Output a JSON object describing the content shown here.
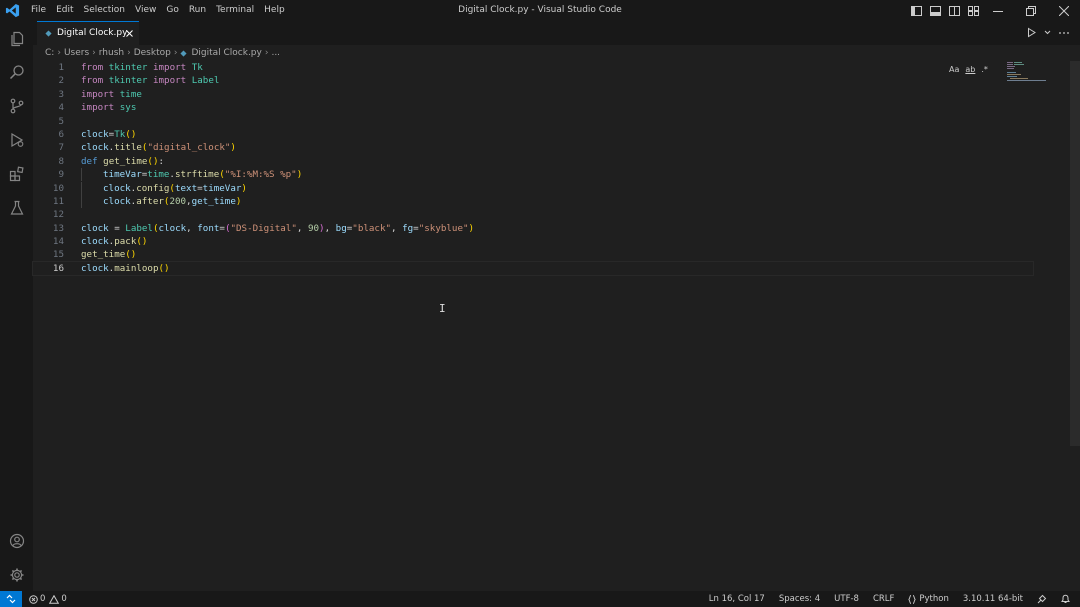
{
  "window": {
    "title": "Digital Clock.py - Visual Studio Code",
    "menu": [
      "File",
      "Edit",
      "Selection",
      "View",
      "Go",
      "Run",
      "Terminal",
      "Help"
    ]
  },
  "tabs": [
    {
      "label": "Digital Clock.py",
      "icon": "python-icon",
      "active": true
    }
  ],
  "breadcrumb": [
    "C:",
    "Users",
    "rhush",
    "Desktop",
    "Digital Clock.py",
    "..."
  ],
  "editor": {
    "current_line": 16,
    "find_widget_labels": [
      "Aa",
      "ab",
      ".*"
    ],
    "code": [
      {
        "n": "1",
        "tokens": [
          [
            "kw",
            "from"
          ],
          [
            "op",
            " "
          ],
          [
            "mod",
            "tkinter"
          ],
          [
            "op",
            " "
          ],
          [
            "kw",
            "import"
          ],
          [
            "op",
            " "
          ],
          [
            "cls",
            "Tk"
          ]
        ]
      },
      {
        "n": "2",
        "tokens": [
          [
            "kw",
            "from"
          ],
          [
            "op",
            " "
          ],
          [
            "mod",
            "tkinter"
          ],
          [
            "op",
            " "
          ],
          [
            "kw",
            "import"
          ],
          [
            "op",
            " "
          ],
          [
            "cls",
            "Label"
          ]
        ]
      },
      {
        "n": "3",
        "tokens": [
          [
            "kw",
            "import"
          ],
          [
            "op",
            " "
          ],
          [
            "mod",
            "time"
          ]
        ]
      },
      {
        "n": "4",
        "tokens": [
          [
            "kw",
            "import"
          ],
          [
            "op",
            " "
          ],
          [
            "mod",
            "sys"
          ]
        ]
      },
      {
        "n": "5",
        "tokens": []
      },
      {
        "n": "6",
        "tokens": [
          [
            "var",
            "clock"
          ],
          [
            "op",
            "="
          ],
          [
            "cls",
            "Tk"
          ],
          [
            "p1",
            "()"
          ]
        ]
      },
      {
        "n": "7",
        "tokens": [
          [
            "var",
            "clock"
          ],
          [
            "op",
            "."
          ],
          [
            "fn",
            "title"
          ],
          [
            "p1",
            "("
          ],
          [
            "str",
            "\"digital_clock\""
          ],
          [
            "p1",
            ")"
          ]
        ]
      },
      {
        "n": "8",
        "tokens": [
          [
            "kw2",
            "def"
          ],
          [
            "op",
            " "
          ],
          [
            "fn",
            "get_time"
          ],
          [
            "p1",
            "()"
          ],
          [
            "op",
            ":"
          ]
        ]
      },
      {
        "n": "9",
        "indent": 1,
        "tokens": [
          [
            "var",
            "timeVar"
          ],
          [
            "op",
            "="
          ],
          [
            "mod",
            "time"
          ],
          [
            "op",
            "."
          ],
          [
            "fn",
            "strftime"
          ],
          [
            "p1",
            "("
          ],
          [
            "str",
            "\"%I:%M:%S %p\""
          ],
          [
            "p1",
            ")"
          ]
        ]
      },
      {
        "n": "10",
        "indent": 1,
        "tokens": [
          [
            "var",
            "clock"
          ],
          [
            "op",
            "."
          ],
          [
            "fn",
            "config"
          ],
          [
            "p1",
            "("
          ],
          [
            "var",
            "text"
          ],
          [
            "op",
            "="
          ],
          [
            "var",
            "timeVar"
          ],
          [
            "p1",
            ")"
          ]
        ]
      },
      {
        "n": "11",
        "indent": 1,
        "tokens": [
          [
            "var",
            "clock"
          ],
          [
            "op",
            "."
          ],
          [
            "fn",
            "after"
          ],
          [
            "p1",
            "("
          ],
          [
            "num",
            "200"
          ],
          [
            "op",
            ","
          ],
          [
            "var",
            "get_time"
          ],
          [
            "p1",
            ")"
          ]
        ]
      },
      {
        "n": "12",
        "tokens": []
      },
      {
        "n": "13",
        "tokens": [
          [
            "var",
            "clock"
          ],
          [
            "op",
            " = "
          ],
          [
            "cls",
            "Label"
          ],
          [
            "p1",
            "("
          ],
          [
            "var",
            "clock"
          ],
          [
            "op",
            ", "
          ],
          [
            "var",
            "font"
          ],
          [
            "op",
            "="
          ],
          [
            "p2",
            "("
          ],
          [
            "str",
            "\"DS-Digital\""
          ],
          [
            "op",
            ", "
          ],
          [
            "num",
            "90"
          ],
          [
            "p2",
            ")"
          ],
          [
            "op",
            ", "
          ],
          [
            "var",
            "bg"
          ],
          [
            "op",
            "="
          ],
          [
            "str",
            "\"black\""
          ],
          [
            "op",
            ", "
          ],
          [
            "var",
            "fg"
          ],
          [
            "op",
            "="
          ],
          [
            "str",
            "\"skyblue\""
          ],
          [
            "p1",
            ")"
          ]
        ]
      },
      {
        "n": "14",
        "tokens": [
          [
            "var",
            "clock"
          ],
          [
            "op",
            "."
          ],
          [
            "fn",
            "pack"
          ],
          [
            "p1",
            "()"
          ]
        ]
      },
      {
        "n": "15",
        "tokens": [
          [
            "fn",
            "get_time"
          ],
          [
            "p1",
            "()"
          ]
        ]
      },
      {
        "n": "16",
        "tokens": [
          [
            "var",
            "clock"
          ],
          [
            "op",
            "."
          ],
          [
            "fn",
            "mainloop"
          ],
          [
            "p1",
            "()"
          ]
        ]
      }
    ]
  },
  "statusbar": {
    "errors": "0",
    "warnings": "0",
    "position": "Ln 16, Col 17",
    "spaces": "Spaces: 4",
    "encoding": "UTF-8",
    "eol": "CRLF",
    "language": "Python",
    "interpreter": "3.10.11 64-bit"
  },
  "colors": {
    "accent": "#0078d4",
    "background": "#1f1f1f",
    "chrome": "#181818"
  }
}
